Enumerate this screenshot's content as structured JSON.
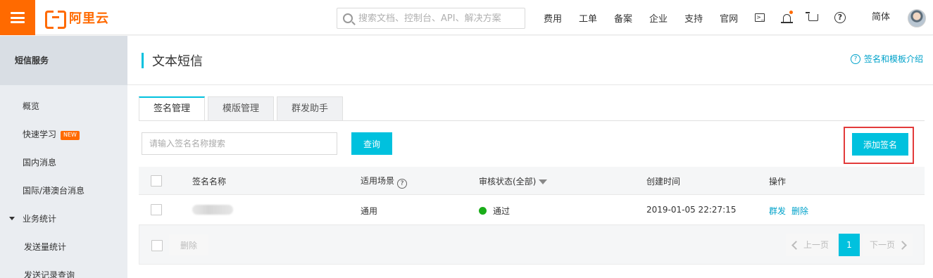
{
  "header": {
    "logo_text": "阿里云",
    "search_placeholder": "搜索文档、控制台、API、解决方案",
    "nav": [
      "费用",
      "工单",
      "备案",
      "企业",
      "支持",
      "官网"
    ],
    "lang": "简体",
    "terminal_glyph": ">_",
    "help_glyph": "?",
    "colors": {
      "brand": "#ff6a00",
      "accent": "#00c1de",
      "link": "#00a2ca",
      "highlight_box": "#e23b3b",
      "status_ok": "#1aad19"
    }
  },
  "sidebar": {
    "title": "短信服务",
    "items": [
      {
        "label": "概览"
      },
      {
        "label": "快速学习",
        "badge": "NEW"
      },
      {
        "label": "国内消息"
      },
      {
        "label": "国际/港澳台消息"
      },
      {
        "label": "业务统计"
      },
      {
        "label": "发送量统计"
      },
      {
        "label": "发送记录查询"
      }
    ]
  },
  "page": {
    "title": "文本短信",
    "help_link": "签名和模板介绍",
    "help_glyph": "?",
    "tabs": [
      {
        "label": "签名管理",
        "active": true
      },
      {
        "label": "模版管理",
        "active": false
      },
      {
        "label": "群发助手",
        "active": false
      }
    ],
    "query_placeholder": "请输入签名名称搜索",
    "query_button": "查询",
    "add_button": "添加签名"
  },
  "table": {
    "columns": {
      "name": "签名名称",
      "scene": "适用场景",
      "status": "审核状态(全部)",
      "created": "创建时间",
      "action": "操作"
    },
    "rows": [
      {
        "scene": "通用",
        "status": "通过",
        "created": "2019-01-05 22:27:15",
        "actions": [
          "群发",
          "删除"
        ]
      }
    ],
    "footer": {
      "delete_button": "删除",
      "prev": "上一页",
      "page": "1",
      "next": "下一页"
    }
  }
}
